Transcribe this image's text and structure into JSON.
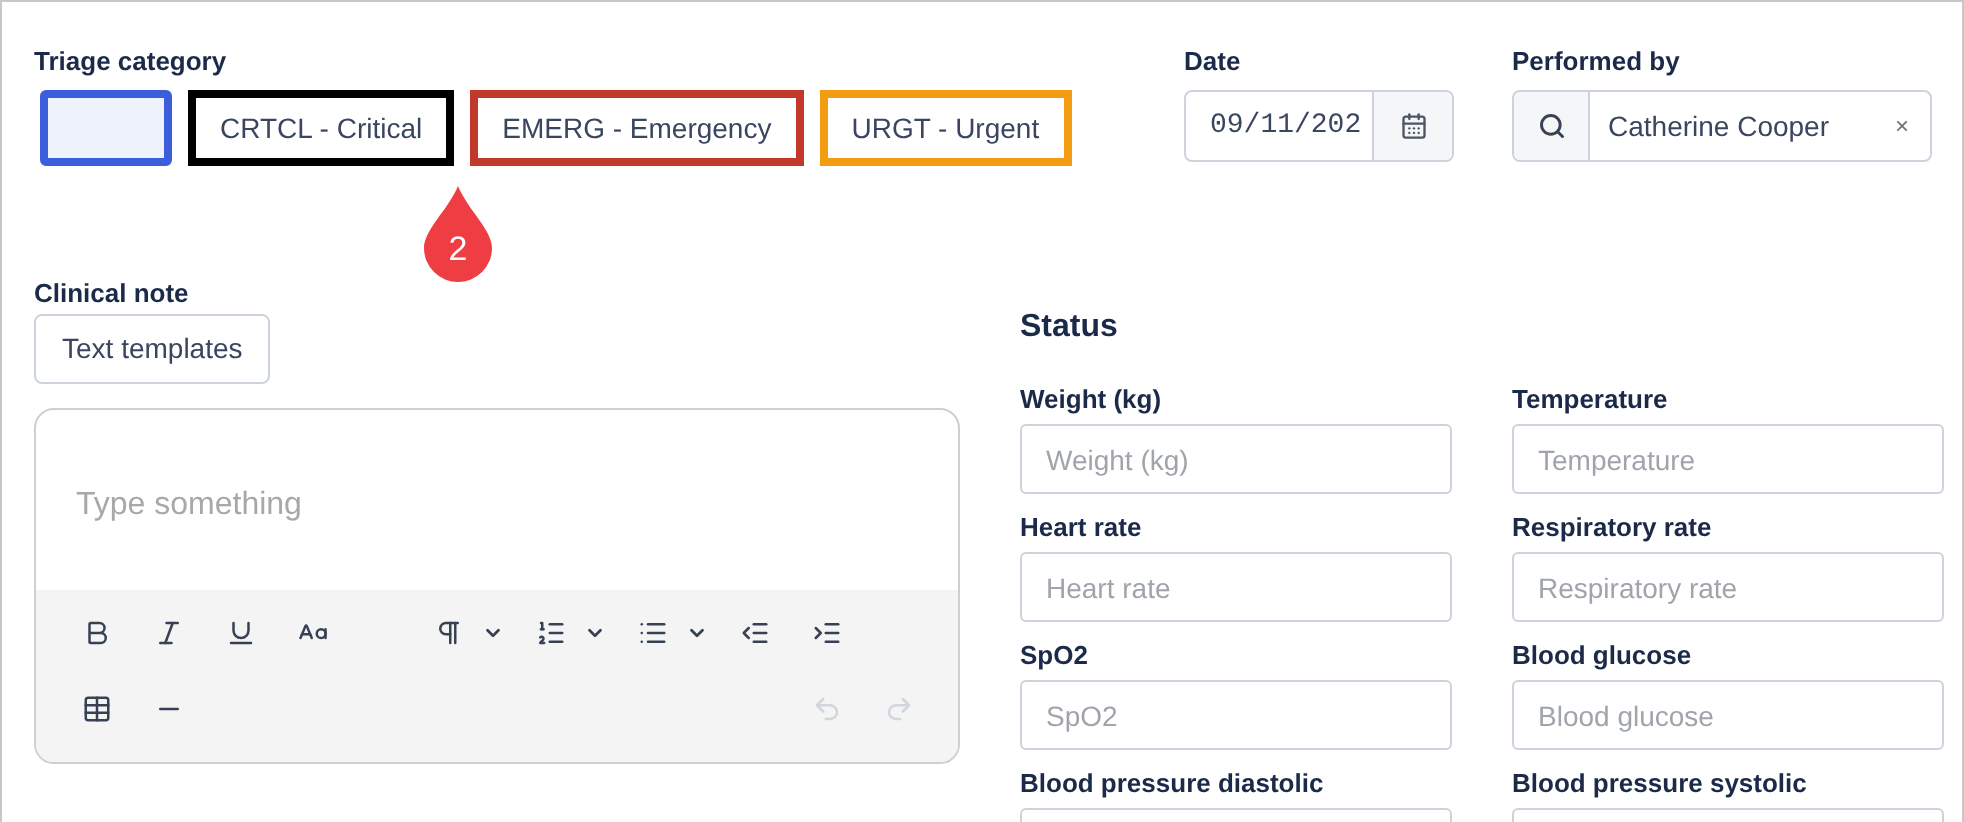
{
  "triage": {
    "label": "Triage category",
    "options": [
      {
        "color": "#3b5fdb",
        "selected": true
      },
      {
        "label": "CRTCL - Critical",
        "color": "#000000",
        "selected": false
      },
      {
        "label": "EMERG - Emergency",
        "color": "#c0392b",
        "selected": false
      },
      {
        "label": "URGT - Urgent",
        "color": "#f39c12",
        "selected": false
      }
    ],
    "marker": "2"
  },
  "date": {
    "label": "Date",
    "value": "09/11/202"
  },
  "performed_by": {
    "label": "Performed by",
    "value": "Catherine Cooper",
    "clear": "×"
  },
  "clinical_note": {
    "label": "Clinical note",
    "templates_button": "Text templates",
    "placeholder": "Type something"
  },
  "status": {
    "title": "Status",
    "fields": [
      {
        "label": "Weight (kg)",
        "placeholder": "Weight (kg)"
      },
      {
        "label": "Temperature",
        "placeholder": "Temperature"
      },
      {
        "label": "Heart rate",
        "placeholder": "Heart rate"
      },
      {
        "label": "Respiratory rate",
        "placeholder": "Respiratory rate"
      },
      {
        "label": "SpO2",
        "placeholder": "SpO2"
      },
      {
        "label": "Blood glucose",
        "placeholder": "Blood glucose"
      },
      {
        "label": "Blood pressure diastolic"
      },
      {
        "label": "Blood pressure systolic"
      }
    ]
  }
}
